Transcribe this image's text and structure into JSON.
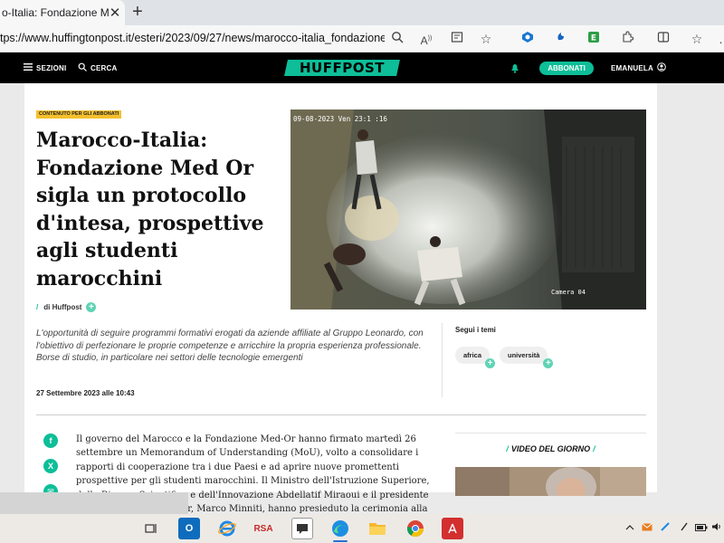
{
  "browser": {
    "tab_title": "o-Italia: Fondazione Med",
    "close_glyph": "✕",
    "newtab_glyph": "+",
    "url_prefix": "tps://",
    "url_main": "www.huffingtonpost.it/esteri/2023/09/27/news/marocco-italia_fondazione...",
    "icons": [
      "search-icon",
      "read-aloud-icon",
      "reader-view-icon",
      "favorite-star-icon",
      "extension-1-icon",
      "extension-2-icon",
      "extension-3-icon",
      "extensions-icon",
      "split-screen-icon",
      "favorites-icon",
      "more-icon"
    ]
  },
  "site": {
    "menu_label": "SEZIONI",
    "search_label": "CERCA",
    "logo_text": "HUFFPOST",
    "subscribe_label": "ABBONATI",
    "user_label": "EMANUELA",
    "accent_color": "#0dbe98"
  },
  "article": {
    "badge": "CONTENUTO PER GLI ABBONATI",
    "title": "Marocco-Italia: Fondazione Med Or sigla un protocollo d'intesa, prospettive agli studenti marocchini",
    "byline_prefix": "/",
    "byline": "di Huffpost",
    "summary": "L'opportunità di seguire programmi formativi erogati da aziende affiliate al Gruppo Leonardo, con l'obiettivo di perfezionare le proprie competenze e arricchire la propria esperienza professionale. Borse di studio, in particolare nei settori delle tecnologie emergenti",
    "date": "27 Settembre 2023 alle 10:43",
    "body": "Il governo del Marocco e la Fondazione Med-Or hanno firmato martedì 26 settembre un Memorandum of Understanding (MoU), volto a consolidare i rapporti di cooperazione tra i due Paesi e ad aprire nuove promettenti prospettive per gli studenti marocchini. Il Ministro dell'Istruzione Superiore, della Ricerca Scientifica e dell'Innovazione Abdellatif Miraoui e il presidente della Fondazione Med-Or, Marco Minniti, hanno presieduto la cerimonia alla presenza dell'Ambasciatore italiano Armando Barucco.",
    "hero_timestamp": "09-08-2023 Ven 23:1 :16",
    "hero_camera": "Camera 04"
  },
  "sidebar": {
    "topics_title": "Segui i temi",
    "topics": [
      "africa",
      "università"
    ],
    "video_title": "VIDEO DEL GIORNO"
  },
  "share": {
    "facebook": "f",
    "twitter": "X",
    "email": "✉"
  },
  "taskbar": {
    "rsa_label": "RSA",
    "tray_icons": [
      "chevron-up-icon",
      "mail-icon",
      "pen-icon",
      "battery-icon",
      "volume-icon"
    ]
  }
}
